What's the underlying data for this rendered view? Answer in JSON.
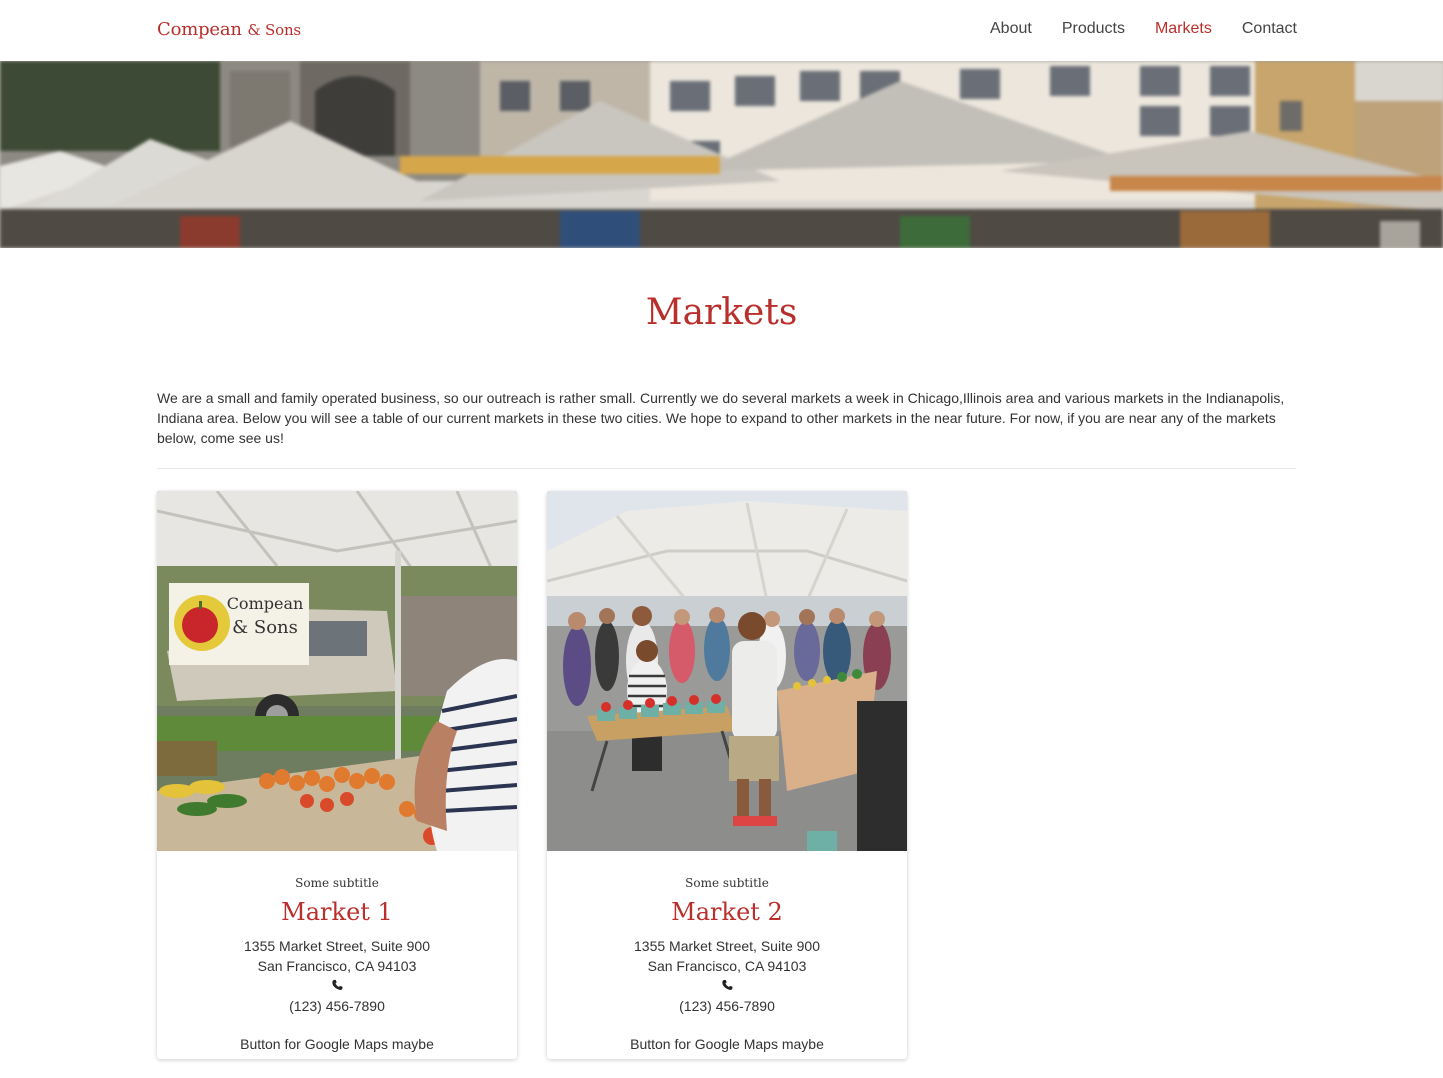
{
  "navbar": {
    "brand_main": "Compean",
    "brand_small": "& Sons",
    "links": [
      {
        "label": "About",
        "active": false
      },
      {
        "label": "Products",
        "active": false
      },
      {
        "label": "Markets",
        "active": true
      },
      {
        "label": "Contact",
        "active": false
      }
    ]
  },
  "hero": {
    "icon": "market-banner-image"
  },
  "main": {
    "title": "Markets",
    "intro": "We are a small and family operated business, so our outreach is rather small. Currently we do several markets a week in Chicago,Illinois area and various markets in the Indianapolis, Indiana area. Below you will see a table of our current markets in these two cities. We hope to expand to other markets in the near future. For now, if you are near any of the markets below, come see us!"
  },
  "markets": [
    {
      "subtitle": "Some subtitle",
      "title": "Market 1",
      "address_line1": "1355 Market Street, Suite 900",
      "address_line2": "San Francisco, CA 94103",
      "phone": "(123) 456-7890",
      "button": "Button for Google Maps maybe",
      "sign_line1": "Compean",
      "sign_line2": "& Sons"
    },
    {
      "subtitle": "Some subtitle",
      "title": "Market 2",
      "address_line1": "1355 Market Street, Suite 900",
      "address_line2": "San Francisco, CA 94103",
      "phone": "(123) 456-7890",
      "button": "Button for Google Maps maybe"
    }
  ],
  "colors": {
    "accent": "#b92f2b",
    "text": "#333333",
    "nav_text": "#444444"
  }
}
